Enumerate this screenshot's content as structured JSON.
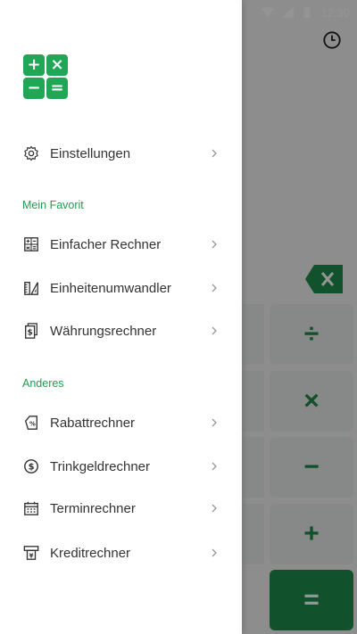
{
  "status_bar": {
    "time": "12:30"
  },
  "keypad": {
    "divide": "÷",
    "multiply": "×",
    "minus": "−",
    "plus": "+",
    "equals": "="
  },
  "logo": {
    "plus": "+",
    "times": "×",
    "minus": "−",
    "equals": "="
  },
  "drawer": {
    "settings": {
      "label": "Einstellungen",
      "icon": "gear-icon"
    },
    "favorites_header": "Mein Favorit",
    "favorites": [
      {
        "label": "Einfacher Rechner",
        "icon": "calculator-icon"
      },
      {
        "label": "Einheitenumwandler",
        "icon": "ruler-icon"
      },
      {
        "label": "Währungsrechner",
        "icon": "currency-icon"
      }
    ],
    "other_header": "Anderes",
    "other": [
      {
        "label": "Rabattrechner",
        "icon": "discount-tag-icon"
      },
      {
        "label": "Trinkgeldrechner",
        "icon": "dollar-coin-icon"
      },
      {
        "label": "Terminrechner",
        "icon": "calendar-icon"
      },
      {
        "label": "Kreditrechner",
        "icon": "loan-icon"
      }
    ]
  },
  "colors": {
    "accent": "#1fa756",
    "equals_key": "#1e8c4c"
  }
}
